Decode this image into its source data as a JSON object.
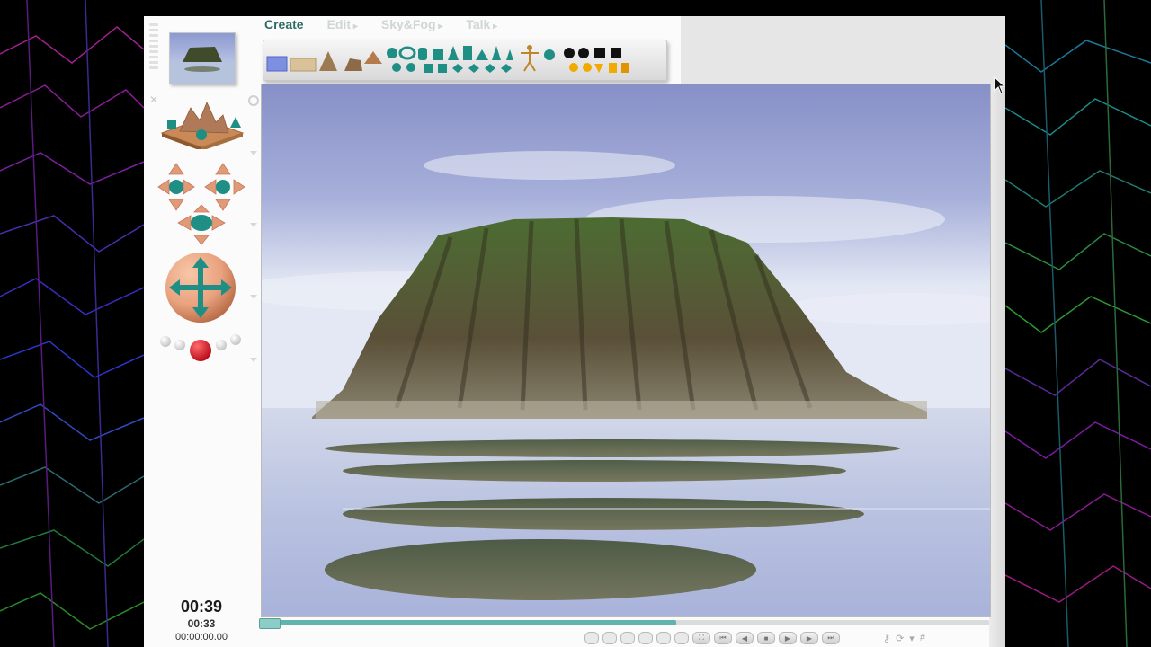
{
  "menu": {
    "tabs": [
      {
        "label": "Create",
        "active": true
      },
      {
        "label": "Edit",
        "active": false
      },
      {
        "label": "Sky&Fog",
        "active": false
      },
      {
        "label": "Talk",
        "active": false
      }
    ]
  },
  "time": {
    "current": "00:39",
    "sub": "00:33",
    "timecode": "00:00:00.00"
  },
  "timeline": {
    "progress": 0.57
  },
  "colors": {
    "accent": "#2f6b63",
    "object_teal": "#1f8f86",
    "move_sphere": "#e9a27e",
    "record_red": "#d8121f",
    "timeline": "#5fb4ae"
  },
  "icons": {
    "move_tool": "four-way-arrows-icon",
    "record": "record-icon",
    "cursor": "mouse-pointer-icon"
  }
}
